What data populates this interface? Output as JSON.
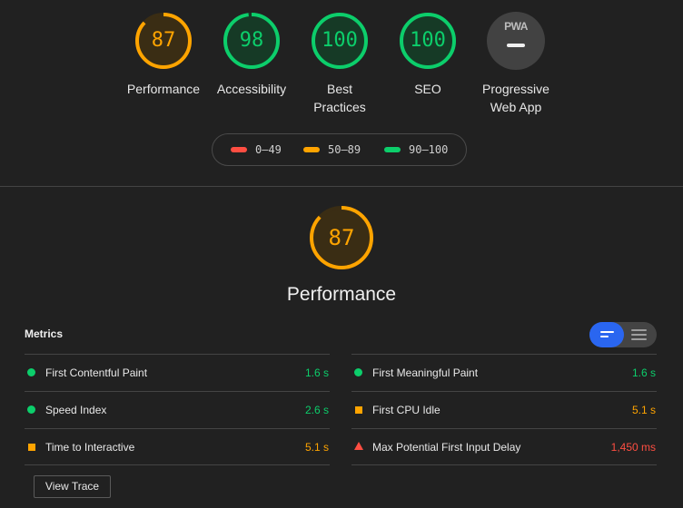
{
  "gauges": [
    {
      "score": "87",
      "label": "Performance",
      "color": "#ffa400",
      "fill": 0.87
    },
    {
      "score": "98",
      "label": "Accessibility",
      "color": "#0cce6b",
      "fill": 0.98
    },
    {
      "score": "100",
      "label": "Best Practices",
      "color": "#0cce6b",
      "fill": 1.0
    },
    {
      "score": "100",
      "label": "SEO",
      "color": "#0cce6b",
      "fill": 1.0
    }
  ],
  "pwa": {
    "badge": "PWA",
    "label_line1": "Progressive",
    "label_line2": "Web App"
  },
  "best_practices_lines": [
    "Best",
    "Practices"
  ],
  "legend": [
    {
      "range": "0–49",
      "color": "#ff4e42"
    },
    {
      "range": "50–89",
      "color": "#ffa400"
    },
    {
      "range": "90–100",
      "color": "#0cce6b"
    }
  ],
  "performance": {
    "score": "87",
    "title": "Performance",
    "fill": 0.87
  },
  "metrics": {
    "heading": "Metrics",
    "left": [
      {
        "name": "First Contentful Paint",
        "value": "1.6 s",
        "status": "pass"
      },
      {
        "name": "Speed Index",
        "value": "2.6 s",
        "status": "pass"
      },
      {
        "name": "Time to Interactive",
        "value": "5.1 s",
        "status": "average"
      }
    ],
    "right": [
      {
        "name": "First Meaningful Paint",
        "value": "1.6 s",
        "status": "pass"
      },
      {
        "name": "First CPU Idle",
        "value": "5.1 s",
        "status": "average"
      },
      {
        "name": "Max Potential First Input Delay",
        "value": "1,450 ms",
        "status": "fail"
      }
    ]
  },
  "view_trace_label": "View Trace",
  "colors": {
    "pass": "#0cce6b",
    "average": "#ffa400",
    "fail": "#ff4e42",
    "toggle_accent": "#2a66f0"
  }
}
